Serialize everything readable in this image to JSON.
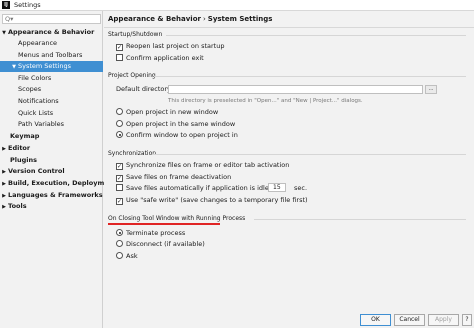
{
  "window": {
    "title": "Settings",
    "app_icon": "IJ"
  },
  "sidebar": {
    "search_glyph": "Q▾",
    "items": [
      {
        "label": "Appearance & Behavior",
        "expanded": true
      },
      {
        "label": "Appearance"
      },
      {
        "label": "Menus and Toolbars"
      },
      {
        "label": "System Settings",
        "selected": true
      },
      {
        "label": "File Colors"
      },
      {
        "label": "Scopes"
      },
      {
        "label": "Notifications"
      },
      {
        "label": "Quick Lists"
      },
      {
        "label": "Path Variables"
      },
      {
        "label": "Keymap"
      },
      {
        "label": "Editor"
      },
      {
        "label": "Plugins"
      },
      {
        "label": "Version Control"
      },
      {
        "label": "Build, Execution, Deployment"
      },
      {
        "label": "Languages & Frameworks"
      },
      {
        "label": "Tools"
      }
    ],
    "arrows": {
      "expanded": "▼",
      "collapsed": "▶"
    }
  },
  "breadcrumb": {
    "parent": "Appearance & Behavior",
    "separator": "›",
    "current": "System Settings"
  },
  "startup": {
    "title": "Startup/Shutdown",
    "reopen_last_project": {
      "label": "Reopen last project on startup",
      "checked": true
    },
    "confirm_exit": {
      "label": "Confirm application exit",
      "checked": false
    }
  },
  "project_opening": {
    "title": "Project Opening",
    "default_directory_label": "Default directory:",
    "default_directory_value": "",
    "browse_label": "...",
    "hint": "This directory is preselected in \"Open...\" and \"New | Project...\" dialogs.",
    "options": [
      {
        "label": "Open project in new window",
        "selected": false
      },
      {
        "label": "Open project in the same window",
        "selected": false
      },
      {
        "label": "Confirm window to open project in",
        "selected": true
      }
    ]
  },
  "synchronization": {
    "title": "Synchronization",
    "sync_on_activation": {
      "label": "Synchronize files on frame or editor tab activation",
      "checked": true
    },
    "save_on_deactivation": {
      "label": "Save files on frame deactivation",
      "checked": true
    },
    "save_if_idle": {
      "label": "Save files automatically if application is idle for",
      "checked": false,
      "value": "15",
      "unit": "sec."
    },
    "safe_write": {
      "label": "Use \"safe write\" (save changes to a temporary file first)",
      "checked": true
    }
  },
  "closing_tool_window": {
    "title": "On Closing Tool Window with Running Process",
    "options": [
      {
        "label": "Terminate process",
        "selected": true
      },
      {
        "label": "Disconnect (if available)",
        "selected": false
      },
      {
        "label": "Ask",
        "selected": false
      }
    ]
  },
  "buttons": {
    "ok": "OK",
    "cancel": "Cancel",
    "apply": "Apply",
    "help": "?"
  },
  "colors": {
    "selection": "#3f8fd2",
    "annotation": "#e02424"
  },
  "checkmark": "✓"
}
